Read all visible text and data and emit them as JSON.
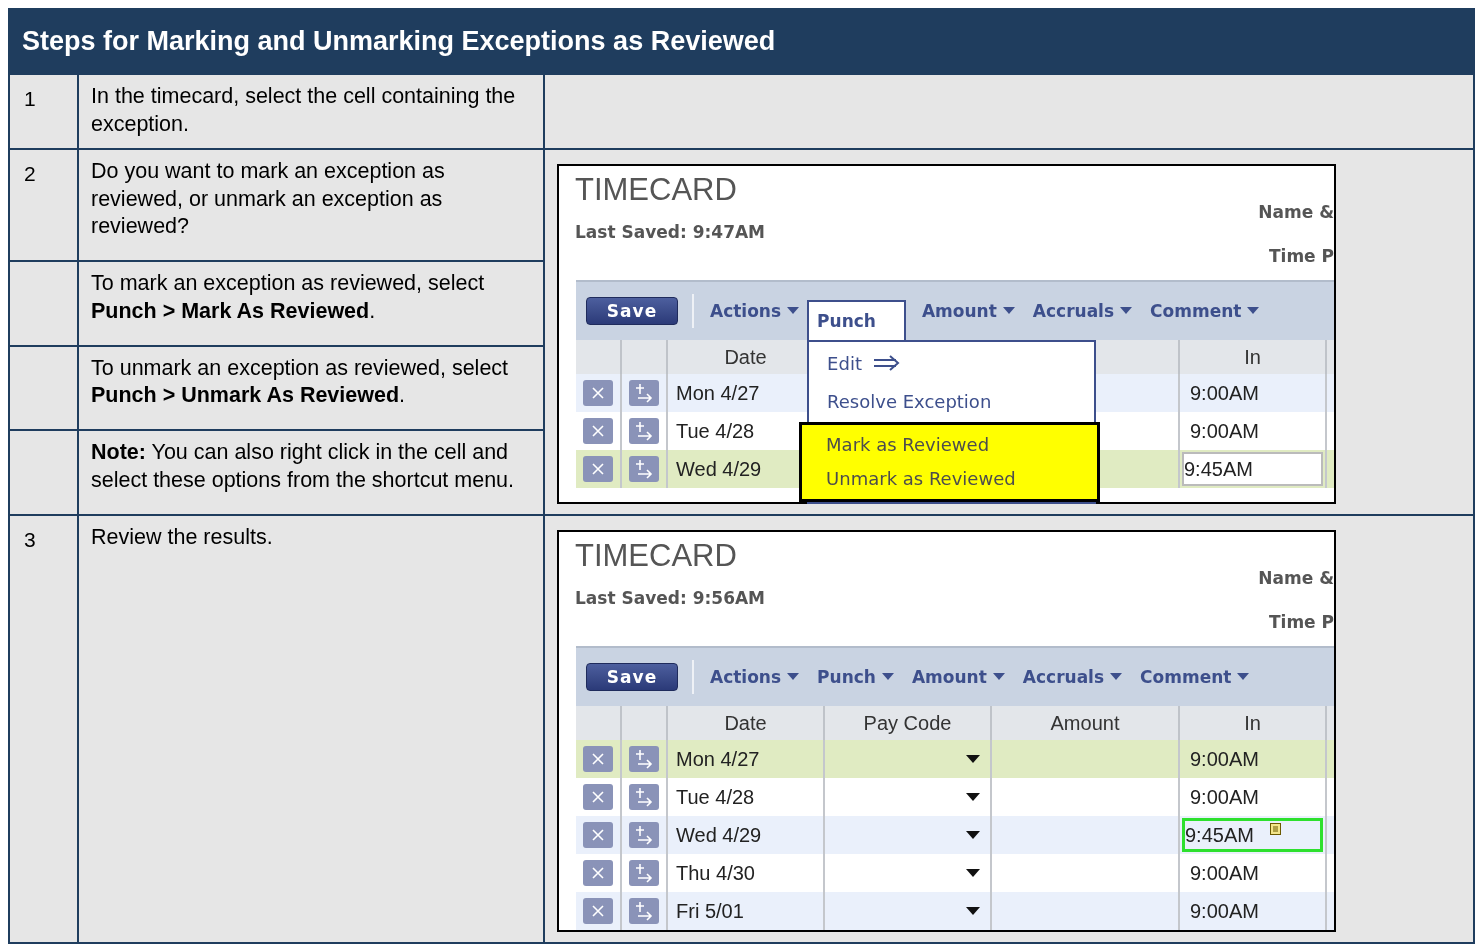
{
  "title": "Steps for Marking and Unmarking Exceptions as Reviewed",
  "steps": [
    {
      "number": "1",
      "parts": [
        "In the timecard, select the cell containing the exception."
      ]
    },
    {
      "number": "2",
      "parts": [
        "Do you want to mark an exception as reviewed, or unmark an exception as reviewed?",
        "To mark an exception as reviewed, select **Punch > Mark As Reviewed**.",
        "To unmark an exception as reviewed, select **Punch > Unmark As Reviewed**.",
        "**Note:** You can also right click in the cell and select these options from the shortcut menu."
      ],
      "screenshot": {
        "title": "TIMECARD",
        "last_saved": "Last Saved: 9:47AM",
        "header_labels": [
          "Name &",
          "Time P"
        ],
        "save_button": "Save",
        "menus": [
          {
            "label": "Actions",
            "open": false
          },
          {
            "label": "Punch",
            "open": true
          },
          {
            "label": "Amount",
            "open": false
          },
          {
            "label": "Accruals",
            "open": false
          },
          {
            "label": "Comment",
            "open": false
          }
        ],
        "dropdown": [
          {
            "label": "Edit",
            "kind": "submenu",
            "highlighted": false
          },
          {
            "label": "Resolve Exception",
            "kind": "action",
            "highlighted": false
          },
          {
            "label": "Mark as Reviewed",
            "kind": "action",
            "highlighted": true
          },
          {
            "label": "Unmark as Reviewed",
            "kind": "action",
            "highlighted": true
          }
        ],
        "columns": [
          {
            "kind": "date",
            "label": "Date"
          },
          {
            "kind": "in",
            "label": "In"
          }
        ],
        "rows": [
          {
            "date": "Mon 4/27",
            "in": "9:00AM",
            "selected": false,
            "editing": false,
            "reviewed": false
          },
          {
            "date": "Tue 4/28",
            "in": "9:00AM",
            "selected": false,
            "editing": false,
            "reviewed": false
          },
          {
            "date": "Wed 4/29",
            "in": "9:45AM",
            "selected": true,
            "editing": true,
            "reviewed": false
          }
        ]
      }
    },
    {
      "number": "3",
      "parts": [
        "Review the results."
      ],
      "screenshot": {
        "title": "TIMECARD",
        "last_saved": "Last Saved: 9:56AM",
        "header_labels": [
          "Name &",
          "Time P"
        ],
        "save_button": "Save",
        "menus": [
          {
            "label": "Actions",
            "open": false
          },
          {
            "label": "Punch",
            "open": false
          },
          {
            "label": "Amount",
            "open": false
          },
          {
            "label": "Accruals",
            "open": false
          },
          {
            "label": "Comment",
            "open": false
          }
        ],
        "columns": [
          {
            "kind": "date",
            "label": "Date"
          },
          {
            "kind": "pay_code",
            "label": "Pay Code"
          },
          {
            "kind": "amount",
            "label": "Amount"
          },
          {
            "kind": "in",
            "label": "In"
          }
        ],
        "rows": [
          {
            "date": "Mon 4/27",
            "in": "9:00AM",
            "selected": true,
            "editing": false,
            "reviewed": false
          },
          {
            "date": "Tue 4/28",
            "in": "9:00AM",
            "selected": false,
            "editing": false,
            "reviewed": false
          },
          {
            "date": "Wed 4/29",
            "in": "9:45AM",
            "selected": false,
            "editing": false,
            "reviewed": true
          },
          {
            "date": "Thu 4/30",
            "in": "9:00AM",
            "selected": false,
            "editing": false,
            "reviewed": false
          },
          {
            "date": "Fri 5/01",
            "in": "9:00AM",
            "selected": false,
            "editing": false,
            "reviewed": false
          }
        ]
      }
    }
  ]
}
